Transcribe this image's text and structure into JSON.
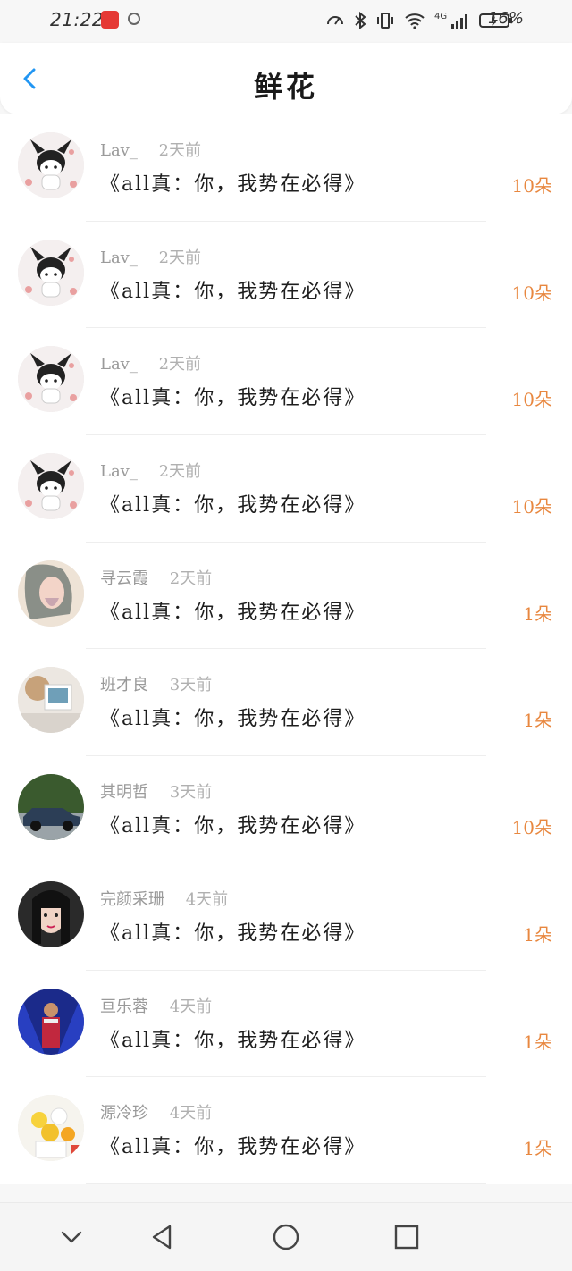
{
  "status_bar": {
    "time": "21:22",
    "battery": "16%",
    "network": "4G"
  },
  "header": {
    "title": "鲜花"
  },
  "colors": {
    "accent": "#2196f3",
    "count": "#e8873f"
  },
  "items": [
    {
      "name": "Lav_",
      "time": "2天前",
      "book": "《all真：你，我势在必得》",
      "count": "10朵",
      "avatar": "kuromi"
    },
    {
      "name": "Lav_",
      "time": "2天前",
      "book": "《all真：你，我势在必得》",
      "count": "10朵",
      "avatar": "kuromi"
    },
    {
      "name": "Lav_",
      "time": "2天前",
      "book": "《all真：你，我势在必得》",
      "count": "10朵",
      "avatar": "kuromi"
    },
    {
      "name": "Lav_",
      "time": "2天前",
      "book": "《all真：你，我势在必得》",
      "count": "10朵",
      "avatar": "kuromi"
    },
    {
      "name": "寻云霞",
      "time": "2天前",
      "book": "《all真：你，我势在必得》",
      "count": "1朵",
      "avatar": "illustration"
    },
    {
      "name": "班才良",
      "time": "3天前",
      "book": "《all真：你，我势在必得》",
      "count": "1朵",
      "avatar": "photo"
    },
    {
      "name": "其明哲",
      "time": "3天前",
      "book": "《all真：你，我势在必得》",
      "count": "10朵",
      "avatar": "car"
    },
    {
      "name": "完颜采珊",
      "time": "4天前",
      "book": "《all真：你，我势在必得》",
      "count": "1朵",
      "avatar": "girl"
    },
    {
      "name": "亘乐蓉",
      "time": "4天前",
      "book": "《all真：你，我势在必得》",
      "count": "1朵",
      "avatar": "stage"
    },
    {
      "name": "源冷珍",
      "time": "4天前",
      "book": "《all真：你，我势在必得》",
      "count": "1朵",
      "avatar": "flowers"
    }
  ]
}
